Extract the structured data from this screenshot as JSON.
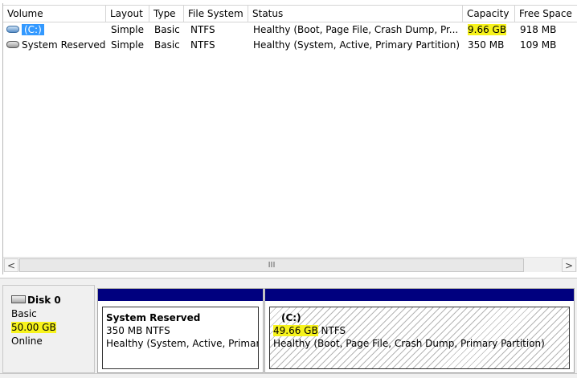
{
  "columns": [
    "Volume",
    "Layout",
    "Type",
    "File System",
    "Status",
    "Capacity",
    "Free Space"
  ],
  "volumes": [
    {
      "icon": "volume-icon-blue",
      "name": "(C:)",
      "layout": "Simple",
      "type": "Basic",
      "file_system": "NTFS",
      "status": "Healthy (Boot, Page File, Crash Dump, Pr...",
      "capacity": "9.66 GB",
      "free_space": "918 MB",
      "selected": true,
      "capacity_highlighted": true
    },
    {
      "icon": "volume-icon",
      "name": "System Reserved",
      "layout": "Simple",
      "type": "Basic",
      "file_system": "NTFS",
      "status": "Healthy (System, Active, Primary Partition)",
      "capacity": "350 MB",
      "free_space": "109 MB",
      "selected": false,
      "capacity_highlighted": false
    }
  ],
  "scrollbar": {
    "left_arrow": "<",
    "right_arrow": ">",
    "thumb_grip": "III"
  },
  "disk": {
    "name": "Disk 0",
    "type": "Basic",
    "size": "50.00 GB",
    "status": "Online"
  },
  "partitions": [
    {
      "name": "System Reserved",
      "size_fs": "350 MB NTFS",
      "status": "Healthy (System, Active, Primary"
    },
    {
      "name": "(C:)",
      "size": "49.66 GB",
      "fs": " NTFS",
      "status": "Healthy (Boot, Page File, Crash Dump, Primary Partition)"
    }
  ],
  "colors": {
    "selection": "#3399ff",
    "highlight": "#f7f31c",
    "partition_bar": "#00007f"
  }
}
